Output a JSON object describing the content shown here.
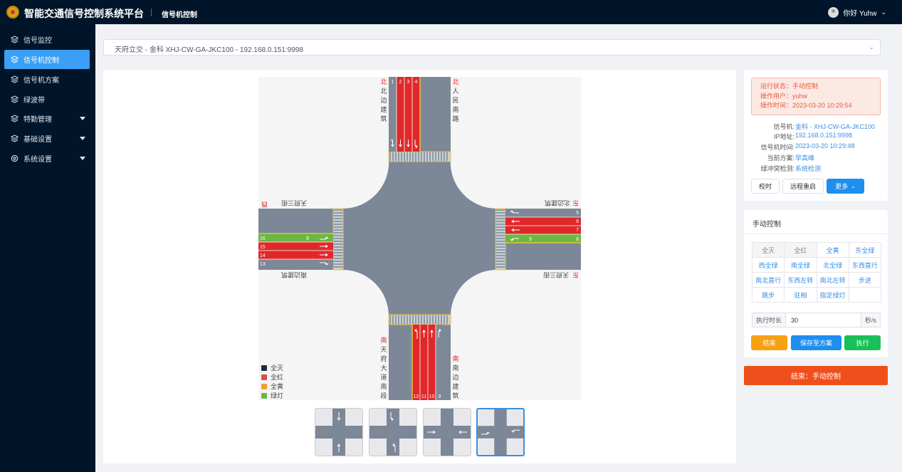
{
  "app": {
    "title": "智能交通信号控制系统平台",
    "crumb": "信号机控制",
    "user_greeting": "你好 Yuhw"
  },
  "sidebar": {
    "items": [
      {
        "label": "信号监控",
        "icon": "layers-icon",
        "active": false,
        "expandable": false
      },
      {
        "label": "信号机控制",
        "icon": "layers-icon",
        "active": true,
        "expandable": false
      },
      {
        "label": "信号机方案",
        "icon": "layers-icon",
        "active": false,
        "expandable": false
      },
      {
        "label": "绿波带",
        "icon": "layers-icon",
        "active": false,
        "expandable": false
      },
      {
        "label": "特勤管理",
        "icon": "layers-icon",
        "active": false,
        "expandable": true
      },
      {
        "label": "基础设置",
        "icon": "layers-icon",
        "active": false,
        "expandable": true
      },
      {
        "label": "系统设置",
        "icon": "settings-icon",
        "active": false,
        "expandable": true
      }
    ]
  },
  "selector": {
    "value": "天府立交  -  金科 XHJ-CW-GA-JKC100  -  192.168.0.151:9998"
  },
  "status": {
    "state": "运行状态：手动控制",
    "user": "操作用户：yuhw",
    "time": "操作时间：2023-03-20 10:29:54"
  },
  "info": [
    {
      "label": "信号机:",
      "value": "金科 - XHJ-CW-GA-JKC100"
    },
    {
      "label": "IP地址:",
      "value": "192.168.0.151:9998"
    },
    {
      "label": "信号机时间:",
      "value": "2023-03-20 10:29:48"
    },
    {
      "label": "当前方案:",
      "value": "早高峰"
    },
    {
      "label": "绿冲突检测:",
      "value": "系统检测"
    }
  ],
  "actions": {
    "sync": "校时",
    "reboot": "远程重启",
    "more": "更多"
  },
  "manual": {
    "title": "手动控制",
    "modes": [
      "全灭",
      "全红",
      "全黄",
      "东全绿",
      "西全绿",
      "南全绿",
      "北全绿",
      "东西直行",
      "南北直行",
      "东西左转",
      "南北左转",
      "步进",
      "跳步",
      "驻相",
      "指定绿灯",
      ""
    ],
    "duration_label": "执行时长",
    "duration_value": "30",
    "duration_unit": "秒/s",
    "end": "结束",
    "save": "保存至方案",
    "execute": "执行"
  },
  "end_bar": "结束：手动控制",
  "map": {
    "north": {
      "dir": "北",
      "left_road": [
        "北",
        "边",
        "建",
        "筑"
      ],
      "right_road": [
        "人",
        "民",
        "南",
        "路"
      ],
      "lanes": [
        "1",
        "2",
        "3",
        "4"
      ]
    },
    "south": {
      "dir": "南",
      "left_road": [
        "天",
        "府",
        "大",
        "道",
        "南",
        "段"
      ],
      "right_road": [
        "南",
        "边",
        "建",
        "筑"
      ],
      "lanes": [
        "12",
        "11",
        "10",
        "9"
      ]
    },
    "east": {
      "dir": "东",
      "top_road": "北边建筑",
      "bottom_road": "天府三街",
      "lanes": [
        "5",
        "6",
        "7",
        "8"
      ],
      "right_turn_lane": "9"
    },
    "west": {
      "dir": "西",
      "top_road": "天府三街",
      "bottom_road": "南边建筑",
      "lanes": [
        "16",
        "15",
        "14",
        "13"
      ],
      "left_turn_lane": "9"
    },
    "legend": [
      {
        "label": "全灭",
        "color": "#1e2a45"
      },
      {
        "label": "全红",
        "color": "#e04a4a"
      },
      {
        "label": "全黄",
        "color": "#f0a030"
      },
      {
        "label": "绿灯",
        "color": "#6ab842"
      }
    ]
  },
  "colors": {
    "red_lane": "#e0282a",
    "green_lane": "#6ab842",
    "grey_lane": "#7e8896",
    "road": "#7c8797",
    "accent": "#3a9ff5",
    "danger": "#f04f1c"
  }
}
